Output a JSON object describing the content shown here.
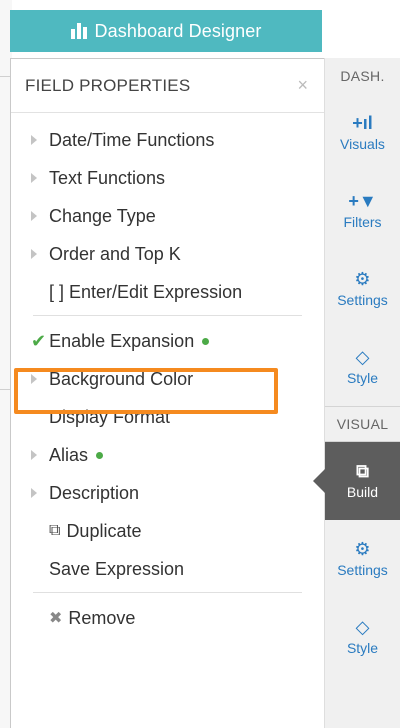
{
  "header": {
    "title": "Dashboard Designer"
  },
  "panel": {
    "title": "FIELD PROPERTIES",
    "close_label": "×"
  },
  "menu": {
    "date_time": "Date/Time Functions",
    "text_functions": "Text Functions",
    "change_type": "Change Type",
    "order_topk": "Order and Top K",
    "enter_edit": "[ ] Enter/Edit Expression",
    "enable_expansion": "Enable Expansion",
    "background_color": "Background Color",
    "display_format": "Display Format",
    "alias": "Alias",
    "description": "Description",
    "duplicate": "Duplicate",
    "save_expression": "Save Expression",
    "remove": "Remove"
  },
  "sidebar": {
    "dash_label": "DASH.",
    "visual_label": "VISUAL",
    "dash_items": [
      {
        "label": "Visuals",
        "icon": "+ıl"
      },
      {
        "label": "Filters",
        "icon": "+▼"
      },
      {
        "label": "Settings",
        "icon": "⚙"
      },
      {
        "label": "Style",
        "icon": "◇"
      }
    ],
    "visual_items": [
      {
        "label": "Build",
        "icon": "⧉"
      },
      {
        "label": "Settings",
        "icon": "⚙"
      },
      {
        "label": "Style",
        "icon": "◇"
      }
    ]
  },
  "colors": {
    "header": "#4fb9c0",
    "accent_blue": "#2a7bc0",
    "highlight": "#f58a1f",
    "status_green": "#4caa47",
    "active_tab": "#5d5d5d"
  }
}
